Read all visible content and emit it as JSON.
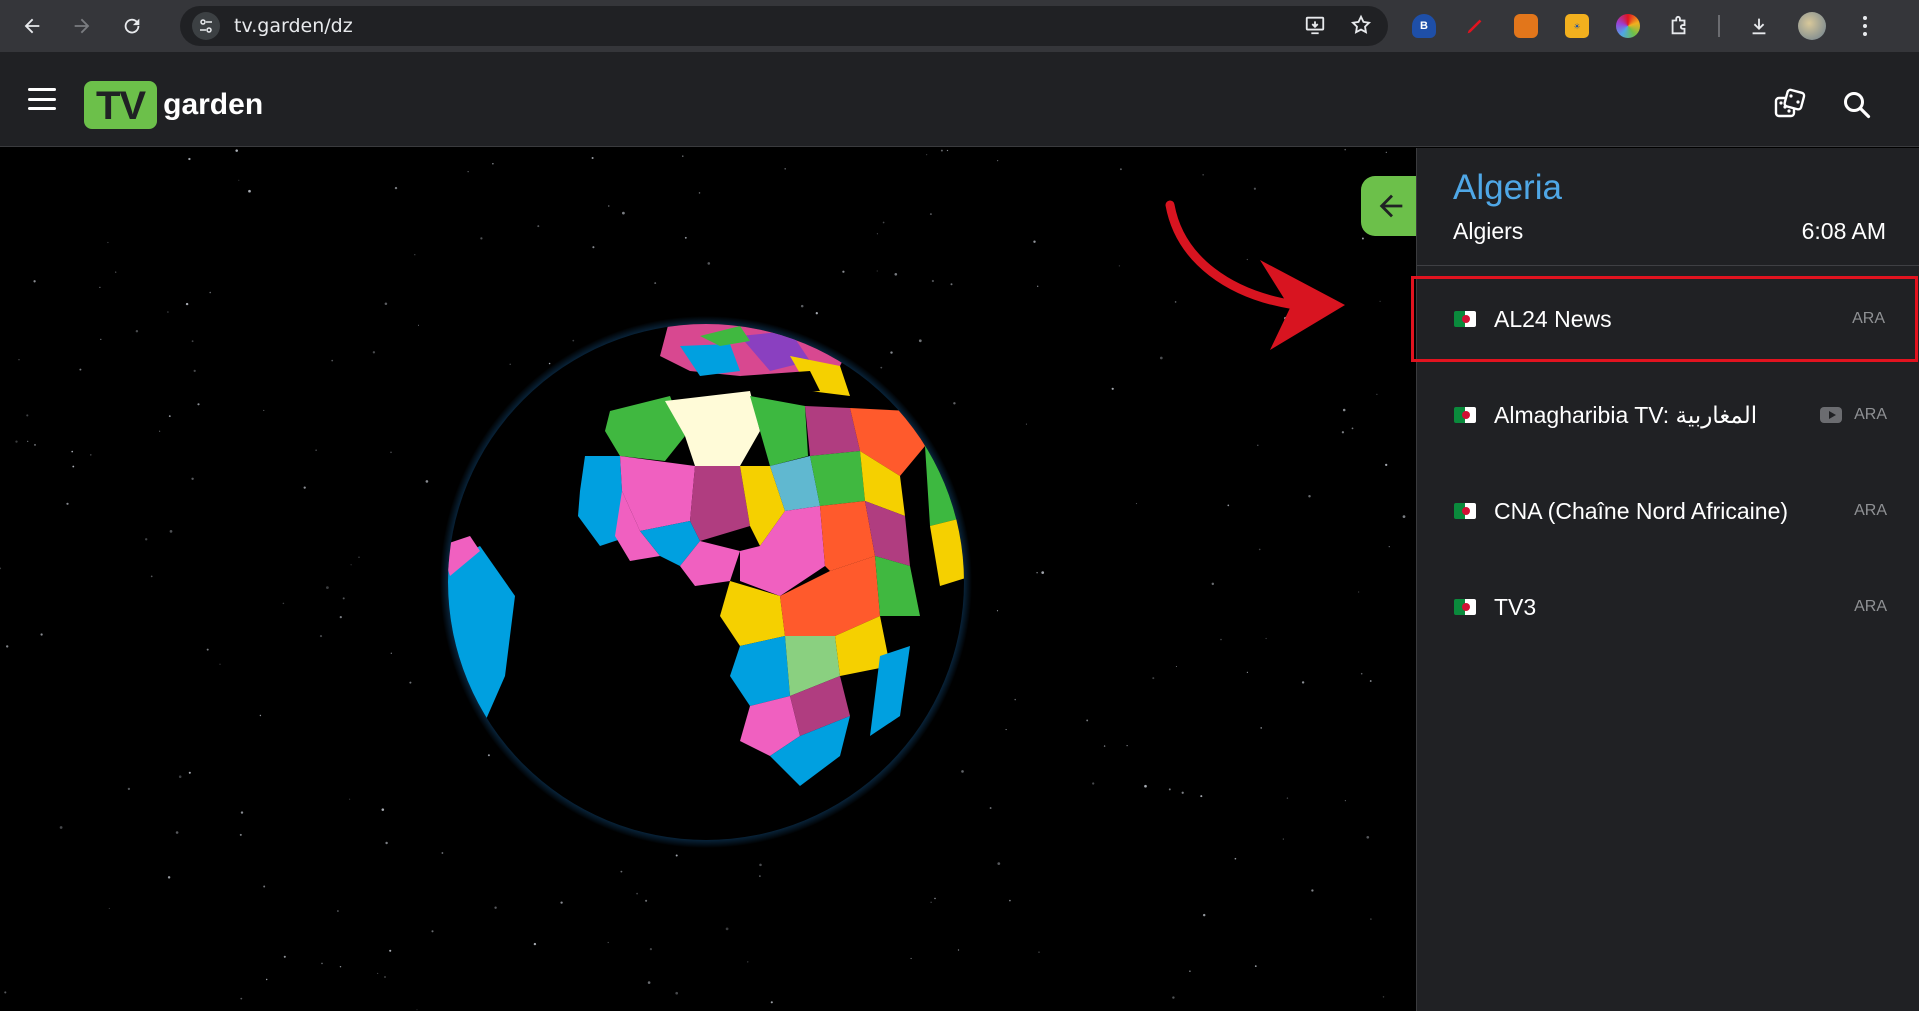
{
  "browser": {
    "url": "tv.garden/dz"
  },
  "app": {
    "logo_tv": "TV",
    "logo_garden": "garden"
  },
  "panel": {
    "country": "Algeria",
    "city": "Algiers",
    "time": "6:08 AM",
    "channels": [
      {
        "name": "AL24 News",
        "lang": "ARA",
        "youtube": false,
        "highlighted": true
      },
      {
        "name": "Almagharibia TV: المغاربية",
        "lang": "ARA",
        "youtube": true,
        "highlighted": false
      },
      {
        "name": "CNA (Chaîne Nord Africaine)",
        "lang": "ARA",
        "youtube": false,
        "highlighted": false
      },
      {
        "name": "TV3",
        "lang": "ARA",
        "youtube": false,
        "highlighted": false
      }
    ]
  },
  "colors": {
    "brand_green": "#6cc04a",
    "country_blue": "#4fa7e6",
    "highlight_red": "#e2131f"
  },
  "icons": {
    "back": "arrow-left-icon",
    "forward": "arrow-right-icon",
    "reload": "reload-icon",
    "menu": "hamburger-icon",
    "random": "dice-icon",
    "search": "search-icon",
    "collapse": "arrow-left-icon"
  }
}
